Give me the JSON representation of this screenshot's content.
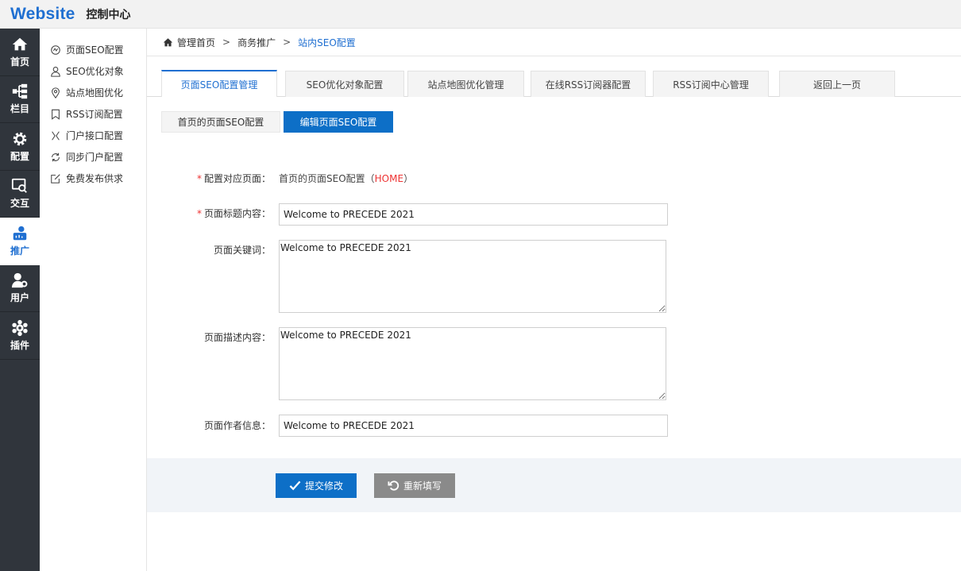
{
  "header": {
    "logo": "Website",
    "title": "控制中心"
  },
  "leftnav": {
    "items": [
      {
        "label": "首页",
        "icon": "home-icon"
      },
      {
        "label": "栏目",
        "icon": "sitemap-icon"
      },
      {
        "label": "配置",
        "icon": "gear-icon"
      },
      {
        "label": "交互",
        "icon": "interaction-icon"
      },
      {
        "label": "推广",
        "icon": "promotion-icon",
        "active": true
      },
      {
        "label": "用户",
        "icon": "user-gear-icon"
      },
      {
        "label": "插件",
        "icon": "plugin-icon"
      }
    ]
  },
  "submenu": {
    "items": [
      {
        "label": "页面SEO配置",
        "icon": "seo-icon"
      },
      {
        "label": "SEO优化对象",
        "icon": "user-icon"
      },
      {
        "label": "站点地图优化",
        "icon": "location-pin-icon"
      },
      {
        "label": "RSS订阅配置",
        "icon": "bookmark-icon"
      },
      {
        "label": "门户接口配置",
        "icon": "link-icon"
      },
      {
        "label": "同步门户配置",
        "icon": "sync-icon"
      },
      {
        "label": "免费发布供求",
        "icon": "edit-icon"
      }
    ]
  },
  "breadcrumb": {
    "home": "管理首页",
    "sep": ">",
    "level1": "商务推广",
    "current": "站内SEO配置"
  },
  "tabs": [
    {
      "label": "页面SEO配置管理",
      "active": true
    },
    {
      "label": "SEO优化对象配置"
    },
    {
      "label": "站点地图优化管理"
    },
    {
      "label": "在线RSS订阅器配置"
    },
    {
      "label": "RSS订阅中心管理"
    },
    {
      "label": "返回上一页"
    }
  ],
  "subtabs": {
    "plain": "首页的页面SEO配置",
    "active": "编辑页面SEO配置"
  },
  "form": {
    "required_mark": "*",
    "page_label": "配置对应页面：",
    "page_value": "首页的页面SEO配置（",
    "page_code": "HOME",
    "page_close": "）",
    "title_label": "页面标题内容：",
    "title_value": "Welcome to PRECEDE 2021",
    "keywords_label": "页面关键词：",
    "keywords_value": "Welcome to PRECEDE 2021",
    "desc_label": "页面描述内容：",
    "desc_value": "Welcome to PRECEDE 2021",
    "author_label": "页面作者信息：",
    "author_value": "Welcome to PRECEDE 2021"
  },
  "buttons": {
    "submit": "提交修改",
    "reset": "重新填写"
  },
  "colors": {
    "accent": "#0d6fc7",
    "nav_bg": "#30353c",
    "required": "#ee3333"
  }
}
